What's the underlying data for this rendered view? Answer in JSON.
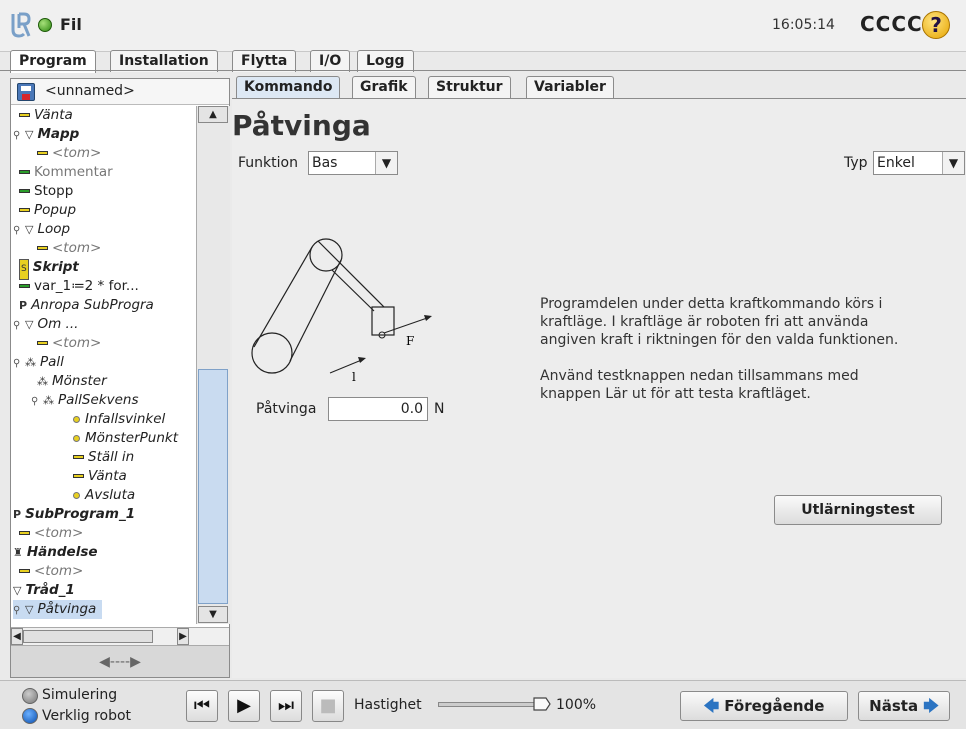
{
  "header": {
    "file_label": "Fil",
    "clock": "16:05:14",
    "robot_name": "CCCC",
    "help": "?"
  },
  "main_tabs": [
    {
      "label": "Program",
      "active": true
    },
    {
      "label": "Installation",
      "active": false
    },
    {
      "label": "Flytta",
      "active": false
    },
    {
      "label": "I/O",
      "active": false
    },
    {
      "label": "Logg",
      "active": false
    }
  ],
  "program_name": "<unnamed>",
  "tree": [
    {
      "label": "Vänta"
    },
    {
      "label": "Mapp"
    },
    {
      "label": "<tom>"
    },
    {
      "label": "Kommentar"
    },
    {
      "label": "Stopp"
    },
    {
      "label": "Popup"
    },
    {
      "label": "Loop"
    },
    {
      "label": "<tom>"
    },
    {
      "label": "Skript"
    },
    {
      "label": "var_1≔2 * for..."
    },
    {
      "label": "Anropa SubProgra"
    },
    {
      "label": "Om ..."
    },
    {
      "label": "<tom>"
    },
    {
      "label": "Pall"
    },
    {
      "label": "Mönster"
    },
    {
      "label": "PallSekvens"
    },
    {
      "label": "Infallsvinkel"
    },
    {
      "label": "MönsterPunkt"
    },
    {
      "label": "Ställ in"
    },
    {
      "label": "Vänta"
    },
    {
      "label": "Avsluta"
    },
    {
      "label": "SubProgram_1"
    },
    {
      "label": "<tom>"
    },
    {
      "label": "Händelse"
    },
    {
      "label": "<tom>"
    },
    {
      "label": "Tråd_1"
    },
    {
      "label": "Påtvinga"
    }
  ],
  "sub_tabs": [
    {
      "label": "Kommando",
      "active": true
    },
    {
      "label": "Grafik",
      "active": false
    },
    {
      "label": "Struktur",
      "active": false
    },
    {
      "label": "Variabler",
      "active": false
    }
  ],
  "command": {
    "title": "Påtvinga",
    "function_label": "Funktion",
    "function_value": "Bas",
    "type_label": "Typ",
    "type_value": "Enkel",
    "force_label": "Påtvinga",
    "force_value": "0.0",
    "force_unit": "N",
    "diagram_F": "F",
    "diagram_l": "l",
    "description_1": "Programdelen under detta kraftkommando körs i kraftläge. I kraftläge är roboten fri att använda angiven kraft i riktningen för den valda funktionen.",
    "description_2": "Använd testknappen nedan tillsammans med knappen Lär ut för att testa kraftläget.",
    "test_button": "Utlärningstest"
  },
  "footer": {
    "simulation": "Simulering",
    "real_robot": "Verklig robot",
    "speed_label": "Hastighet",
    "speed_value": "100%",
    "speed_fraction": 1.0,
    "prev": "Föregående",
    "next": "Nästa"
  }
}
